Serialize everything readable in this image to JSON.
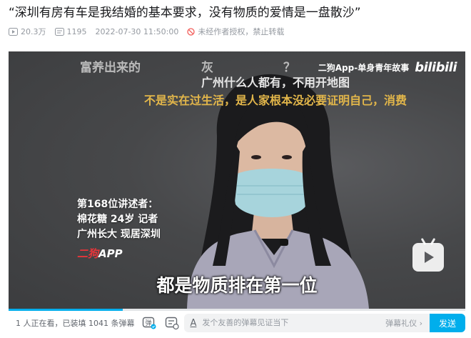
{
  "video": {
    "title": "“深圳有房有车是我结婚的基本要求，没有物质的爱情是一盘散沙”",
    "views": "20.3万",
    "danmaku_count": "1195",
    "publish_time": "2022-07-30 11:50:00",
    "copyright_notice": "未经作者授权，禁止转载"
  },
  "player": {
    "danmaku": [
      "富养出来的",
      "灰",
      "？",
      "广州什么人都有，不用开地图",
      "不是实在过生活，是人家根本没必要证明自己，消费"
    ],
    "brand_text": "二狗App-单身青年故事",
    "brand_logo": "bilibili",
    "narrator_lines": [
      "第168位讲述者：",
      "棉花糖 24岁 记者",
      "广州长大 现居深圳"
    ],
    "app_logo_red": "二狗",
    "app_logo_white": "APP",
    "subtitle": "都是物质排在第一位",
    "progress": 0.25
  },
  "sendbar": {
    "watching": "1 人正在看，已装填 1041 条弹幕",
    "placeholder": "发个友善的弹幕见证当下",
    "etiquette": "弹幕礼仪 ›",
    "send_label": "发送",
    "danmaku_toggle_icon": "弹",
    "settings_icon": "danmaku-settings-icon"
  },
  "colors": {
    "accent": "#00aeec",
    "muted_text": "#9499a0",
    "danmaku_yellow": "#e2b64a",
    "app_red": "#e8353a"
  }
}
